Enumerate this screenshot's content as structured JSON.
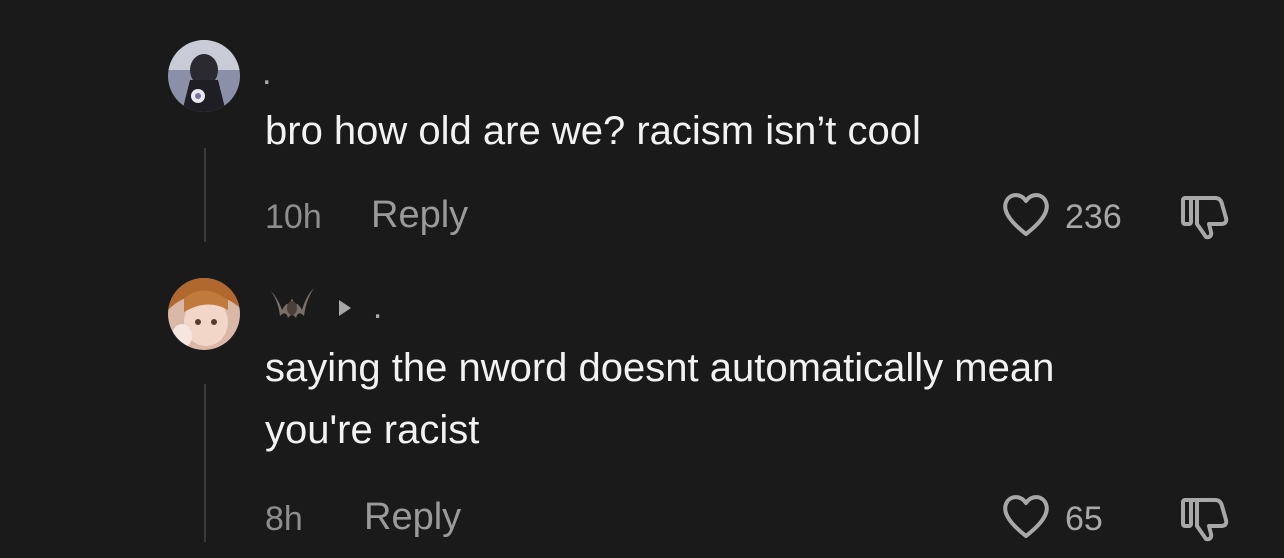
{
  "comments": [
    {
      "username": ".",
      "text": "bro how old are we? racism isn’t cool",
      "time": "10h",
      "reply_label": "Reply",
      "likes": "236",
      "avatar_icon": "avatar-dark-figure",
      "like_icon": "heart-outline-icon",
      "dislike_icon": "thumbs-down-outline-icon"
    },
    {
      "username_prefix_icon": "bat-emoji",
      "username_arrow_icon": "play-triangle-icon",
      "username": ".",
      "text": "saying the nword doesnt automatically mean\nyou're racist",
      "time": "8h",
      "reply_label": "Reply",
      "likes": "65",
      "avatar_icon": "avatar-anime-character",
      "like_icon": "heart-outline-icon",
      "dislike_icon": "thumbs-down-outline-icon"
    }
  ],
  "colors": {
    "background": "#1a1a1a",
    "text": "#f2f2f2",
    "secondary_text": "#9a9a9a"
  }
}
